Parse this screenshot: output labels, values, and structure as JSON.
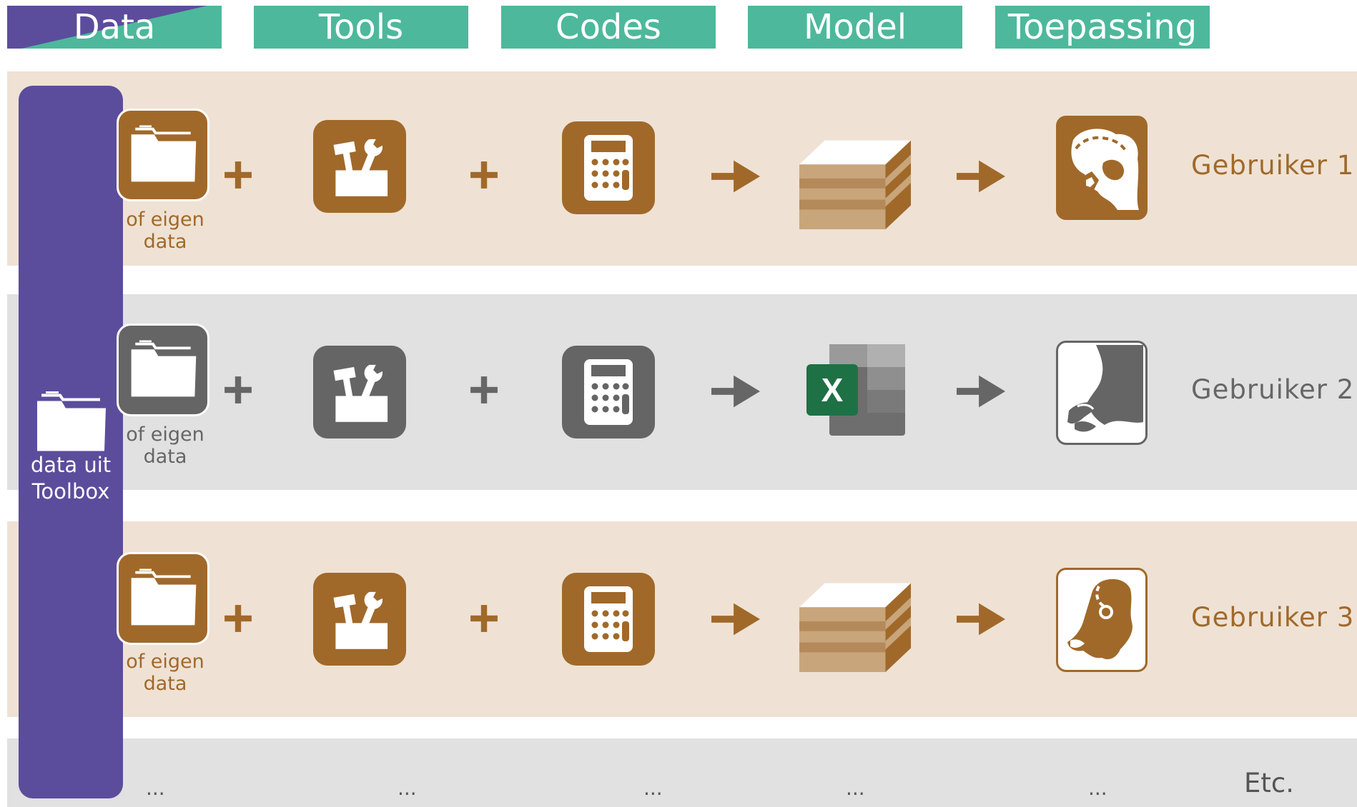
{
  "headers": {
    "data": "Data",
    "tools": "Tools",
    "codes": "Codes",
    "model": "Model",
    "toepassing": "Toepassing"
  },
  "toolbox": {
    "line1": "data uit",
    "line2": "Toolbox",
    "icon": "folder-icon"
  },
  "rows": [
    {
      "eigen_line1": "of eigen",
      "eigen_line2": "data",
      "plus": "+",
      "user": "Gebruiker 1",
      "model_icon": "layered-block-icon",
      "map_icon": "map-detail-icon"
    },
    {
      "eigen_line1": "of eigen",
      "eigen_line2": "data",
      "plus": "+",
      "user": "Gebruiker 2",
      "model_icon": "excel-icon",
      "map_icon": "coast-map-icon",
      "excel_letter": "X"
    },
    {
      "eigen_line1": "of eigen",
      "eigen_line2": "data",
      "plus": "+",
      "user": "Gebruiker 3",
      "model_icon": "layered-block-icon",
      "map_icon": "netherlands-map-icon"
    }
  ],
  "footer": {
    "ellipsis": "...",
    "etc": "Etc."
  },
  "colors": {
    "purple": "#5b4d9c",
    "teal": "#4db89c",
    "brown": "#a0692a",
    "gray": "#656565",
    "band_brown": "#efe2d4",
    "band_gray": "#e1e1e1"
  }
}
